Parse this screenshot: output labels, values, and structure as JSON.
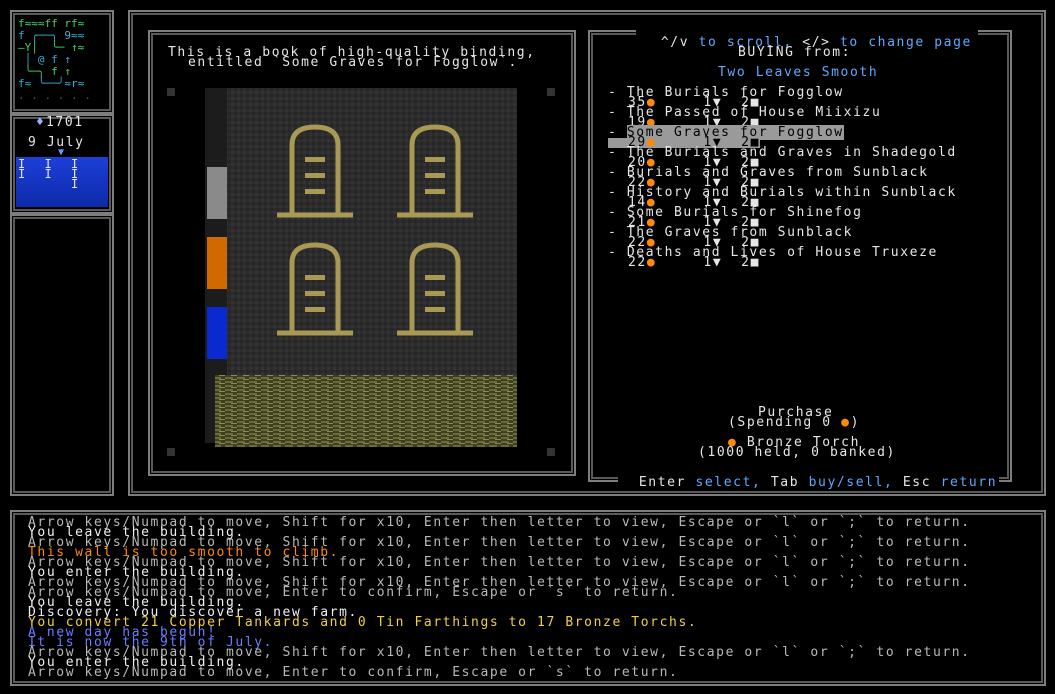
{
  "sidebar": {
    "gold": "1701",
    "date": "9 July",
    "minimap_rows": [
      "f≈≈≈ff rf≈",
      "f ╭──╮ 9≈≈",
      "—Y│  ╰─ ↑≈",
      " │ @ f ↑ ",
      " ╰─╮ f ↑",
      "f≈ ╰──╯≈r≈",
      ". . . . . ."
    ],
    "calendar_marks": [
      "I  I  I",
      "I  I  I",
      "      I"
    ]
  },
  "book": {
    "description_line1": "This is a book of high-quality binding,",
    "description_line2": "entitled `Some Graves for Fogglow`."
  },
  "shop": {
    "help": "^/v to scroll, </> to change page",
    "help_parts": [
      "^/v",
      " to scroll, ",
      "</>",
      " to change page"
    ],
    "buying_label": "BUYING from:",
    "seller": "Two Leaves Smooth",
    "items": [
      {
        "title": "The Burials for Fogglow",
        "price": "35",
        "weight": "1",
        "count": "2",
        "selected": false
      },
      {
        "title": "The Passed of House Miixizu",
        "price": "19",
        "weight": "1",
        "count": "2",
        "selected": false
      },
      {
        "title": "Some Graves for Fogglow",
        "price": "29",
        "weight": "1",
        "count": "2",
        "selected": true
      },
      {
        "title": "The Burials and Graves in Shadegold",
        "price": "20",
        "weight": "1",
        "count": "2",
        "selected": false
      },
      {
        "title": "Burials and Graves from Sunblack",
        "price": "22",
        "weight": "1",
        "count": "2",
        "selected": false
      },
      {
        "title": "History and Burials within Sunblack",
        "price": "14",
        "weight": "1",
        "count": "2",
        "selected": false
      },
      {
        "title": "Some Burials for Shinefog",
        "price": "21",
        "weight": "1",
        "count": "2",
        "selected": false
      },
      {
        "title": "The Graves from Sunblack",
        "price": "22",
        "weight": "1",
        "count": "2",
        "selected": false
      },
      {
        "title": "Deaths and Lives of House Truxeze",
        "price": "22",
        "weight": "1",
        "count": "2",
        "selected": false
      }
    ],
    "purchase_label": "Purchase",
    "spending": "(Spending 0",
    "currency_name": "Bronze Torch",
    "currency_held": "(1000 held, 0 banked)",
    "footer": {
      "enter": "Enter",
      "select": "select,",
      "tab": "Tab",
      "buysell": "buy/sell,",
      "esc": "Esc",
      "return": "return"
    }
  },
  "log": [
    {
      "text": "Arrow keys/Numpad to move, Shift for x10, Enter then letter to view, Escape or `l` or `;` to return.",
      "color": "grey"
    },
    {
      "text": "You leave the building.",
      "color": "white"
    },
    {
      "text": "Arrow keys/Numpad to move, Shift for x10, Enter then letter to view, Escape or `l` or `;` to return.",
      "color": "grey"
    },
    {
      "text": "This wall is too smooth to climb.",
      "color": "orange"
    },
    {
      "text": "Arrow keys/Numpad to move, Shift for x10, Enter then letter to view, Escape or `l` or `;` to return.",
      "color": "grey"
    },
    {
      "text": "You enter the building.",
      "color": "white"
    },
    {
      "text": "Arrow keys/Numpad to move, Shift for x10, Enter then letter to view, Escape or `l` or `;` to return.",
      "color": "grey"
    },
    {
      "text": "Arrow keys/Numpad to move, Enter to confirm, Escape or `s` to return.",
      "color": "grey"
    },
    {
      "text": "You leave the building.",
      "color": "white"
    },
    {
      "text": "Discovery: You discover a new farm.",
      "color": "white"
    },
    {
      "text": "You convert 21 Copper Tankards and 0 Tin Farthings to 17 Bronze Torchs.",
      "color": "yellow"
    },
    {
      "text": "A new day has begun!",
      "color": "blue"
    },
    {
      "text": "It is now the 9th of July.",
      "color": "blue"
    },
    {
      "text": "Arrow keys/Numpad to move, Shift for x10, Enter then letter to view, Escape or `l` or `;` to return.",
      "color": "grey"
    },
    {
      "text": "You enter the building.",
      "color": "white"
    },
    {
      "text": "Arrow keys/Numpad to move, Enter to confirm, Escape or `s` to return.",
      "color": "grey"
    }
  ]
}
